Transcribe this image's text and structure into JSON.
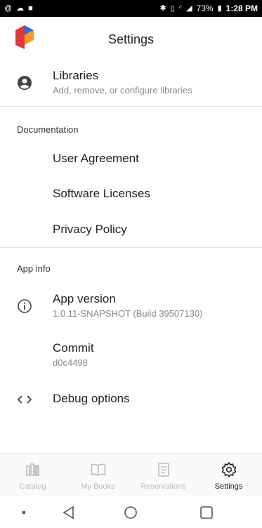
{
  "status_bar": {
    "left_icons": [
      "@",
      "☁",
      "■"
    ],
    "right_text": "73%",
    "time": "1:28 PM"
  },
  "header": {
    "title": "Settings"
  },
  "libraries": {
    "title": "Libraries",
    "subtitle": "Add, remove, or configure libraries"
  },
  "documentation": {
    "section_title": "Documentation",
    "items": [
      "User Agreement",
      "Software Licenses",
      "Privacy Policy"
    ]
  },
  "app_info": {
    "section_title": "App info",
    "version_title": "App version",
    "version_value": "1.0.11-SNAPSHOT (Build 39507130)",
    "commit_title": "Commit",
    "commit_value": "d0c4498",
    "debug_title": "Debug options"
  },
  "bottom_nav": {
    "tabs": [
      {
        "label": "Catalog",
        "icon": "catalog-icon"
      },
      {
        "label": "My Books",
        "icon": "book-icon"
      },
      {
        "label": "Reservations",
        "icon": "reservations-icon"
      },
      {
        "label": "Settings",
        "icon": "gear-icon"
      }
    ],
    "active": "Settings"
  },
  "colors": {
    "accent": "#222222",
    "inactive": "#bbbbbb",
    "secondary_text": "#888888",
    "logo_red": "#e2373a",
    "logo_blue": "#2f6fdc",
    "logo_orange": "#f39b24"
  }
}
